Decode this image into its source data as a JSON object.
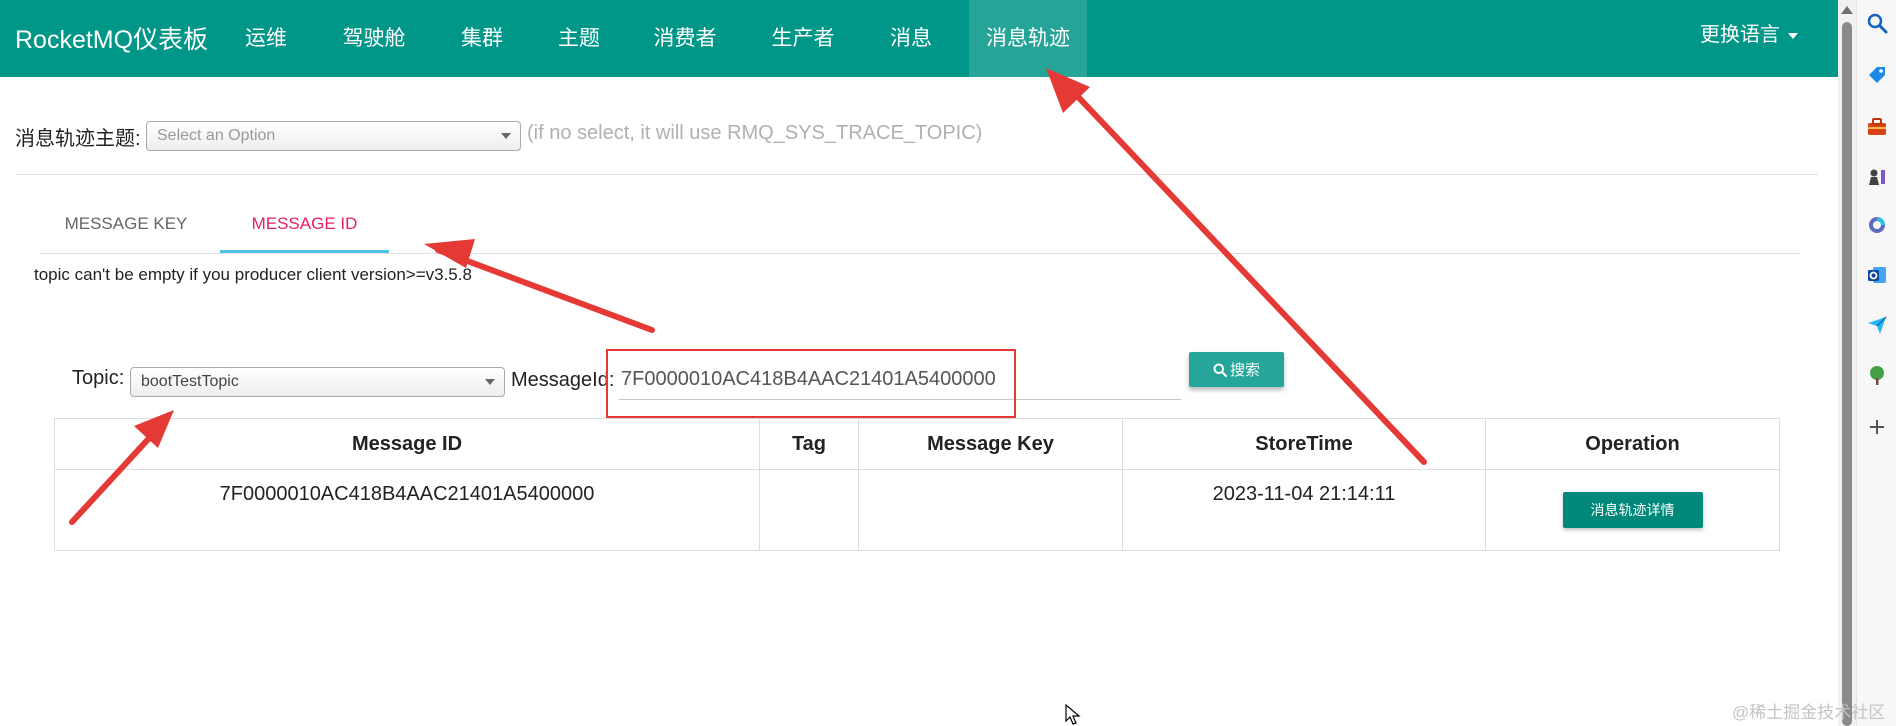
{
  "app": {
    "brand": "RocketMQ仪表板",
    "nav": [
      {
        "label": "运维"
      },
      {
        "label": "驾驶舱"
      },
      {
        "label": "集群"
      },
      {
        "label": "主题"
      },
      {
        "label": "消费者"
      },
      {
        "label": "生产者"
      },
      {
        "label": "消息"
      },
      {
        "label": "消息轨迹"
      }
    ],
    "language_label": "更换语言"
  },
  "trace": {
    "topic_label": "消息轨迹主题:",
    "topic_placeholder": "Select an Option",
    "hint": "(if no select, it will use RMQ_SYS_TRACE_TOPIC)"
  },
  "tabs": [
    {
      "label": "MESSAGE KEY"
    },
    {
      "label": "MESSAGE ID"
    }
  ],
  "note": "topic can't be empty if you producer client version>=v3.5.8",
  "search": {
    "topic_label": "Topic:",
    "topic_value": "bootTestTopic",
    "messageid_label": "MessageId:",
    "messageid_value": "7F0000010AC418B4AAC21401A5400000",
    "button_label": "搜索"
  },
  "table": {
    "headers": [
      "Message ID",
      "Tag",
      "Message Key",
      "StoreTime",
      "Operation"
    ],
    "rows": [
      {
        "message_id": "7F0000010AC418B4AAC21401A5400000",
        "tag": "",
        "message_key": "",
        "store_time": "2023-11-04 21:14:11",
        "operation": "消息轨迹详情"
      }
    ]
  },
  "watermark": "@稀土掘金技术社区",
  "colors": {
    "navbar": "#009688",
    "nav_active": "#26a497",
    "button": "#26a69a",
    "tab_active_text": "#e91e63",
    "tab_indicator": "#4fc3e6",
    "annotation": "#e53935"
  },
  "sidebar_icons": [
    "search-icon",
    "tag-icon",
    "toolbox-icon",
    "chess-icon",
    "copilot-icon",
    "outlook-icon",
    "send-icon",
    "tree-icon",
    "plus-icon"
  ]
}
